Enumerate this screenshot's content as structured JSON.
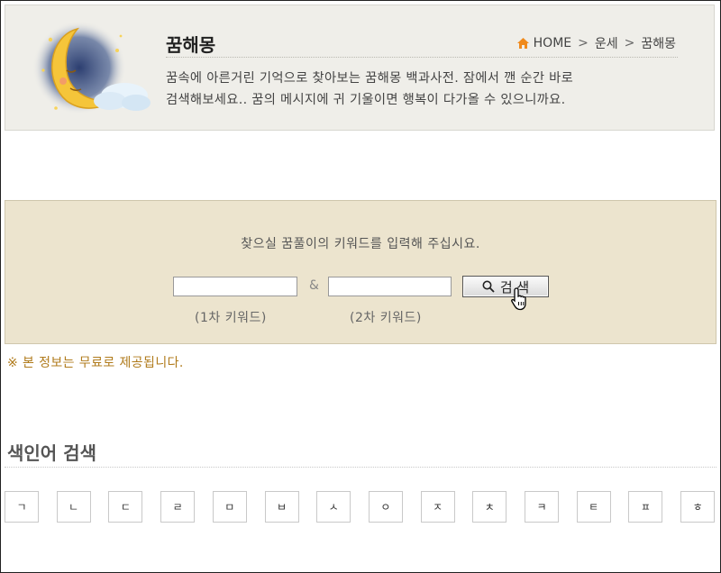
{
  "header": {
    "title": "꿈해몽",
    "breadcrumb": [
      "HOME",
      "운세",
      "꿈해몽"
    ],
    "description_line1": "꿈속에 아른거린 기억으로 찾아보는 꿈해몽 백과사전. 잠에서 깬 순간 바로",
    "description_line2": "검색해보세요.. 꿈의 메시지에 귀 기울이면 행복이 다가올 수 있으니까요."
  },
  "search": {
    "prompt": "찾으실 꿈풀이의 키워드를 입력해 주십시요.",
    "keyword1_value": "",
    "keyword2_value": "",
    "ampersand": "&",
    "button_label": "검 색",
    "keyword1_label": "(1차 키워드)",
    "keyword2_label": "(2차 키워드)"
  },
  "notice": "※ 본 정보는 무료로 제공됩니다.",
  "index": {
    "title": "색인어 검색",
    "keys": [
      "ㄱ",
      "ㄴ",
      "ㄷ",
      "ㄹ",
      "ㅁ",
      "ㅂ",
      "ㅅ",
      "ㅇ",
      "ㅈ",
      "ㅊ",
      "ㅋ",
      "ㅌ",
      "ㅍ",
      "ㅎ"
    ]
  },
  "colors": {
    "header_bg": "#efeee9",
    "search_bg": "#ece4ce",
    "notice": "#b07b1c",
    "home_icon": "#f08a1c"
  },
  "icons": [
    "moon-illustration",
    "home-icon",
    "magnifier-icon",
    "hand-cursor-icon"
  ]
}
